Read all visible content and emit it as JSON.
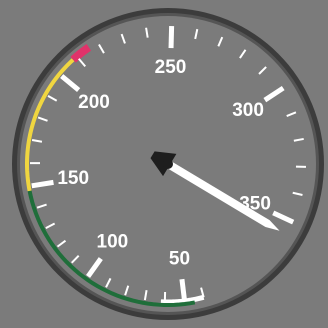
{
  "gauge": {
    "label_values": [
      50,
      100,
      150,
      200,
      250,
      300,
      350
    ],
    "label_texts": [
      "50",
      "100",
      "150",
      "200",
      "250",
      "300",
      "350"
    ],
    "major_tick_values": [
      50,
      100,
      150,
      200,
      250,
      300,
      350
    ],
    "minor_tick_values": [
      40,
      60,
      70,
      80,
      90,
      110,
      120,
      130,
      140,
      160,
      170,
      180,
      190,
      210,
      220,
      230,
      240,
      260,
      270,
      280,
      290,
      310,
      320,
      330,
      340
    ],
    "needle_value": 355,
    "arcs": [
      {
        "name": "green-arc",
        "from": 45,
        "to": 148,
        "color": "#1f6e3a"
      },
      {
        "name": "yellow-arc",
        "from": 148,
        "to": 208,
        "color": "#f0d640"
      },
      {
        "name": "red-arc",
        "from": 208,
        "to": 216,
        "color": "#e0336a"
      }
    ],
    "colors": {
      "face": "#7b7b7b",
      "bezel": "#3c3c3c",
      "marking": "#ffffff",
      "white_arc_band": "#ffffff",
      "needle": "#ffffff",
      "hub": "#1e1e1e"
    },
    "white_band": {
      "from": 40,
      "to": 62
    }
  }
}
